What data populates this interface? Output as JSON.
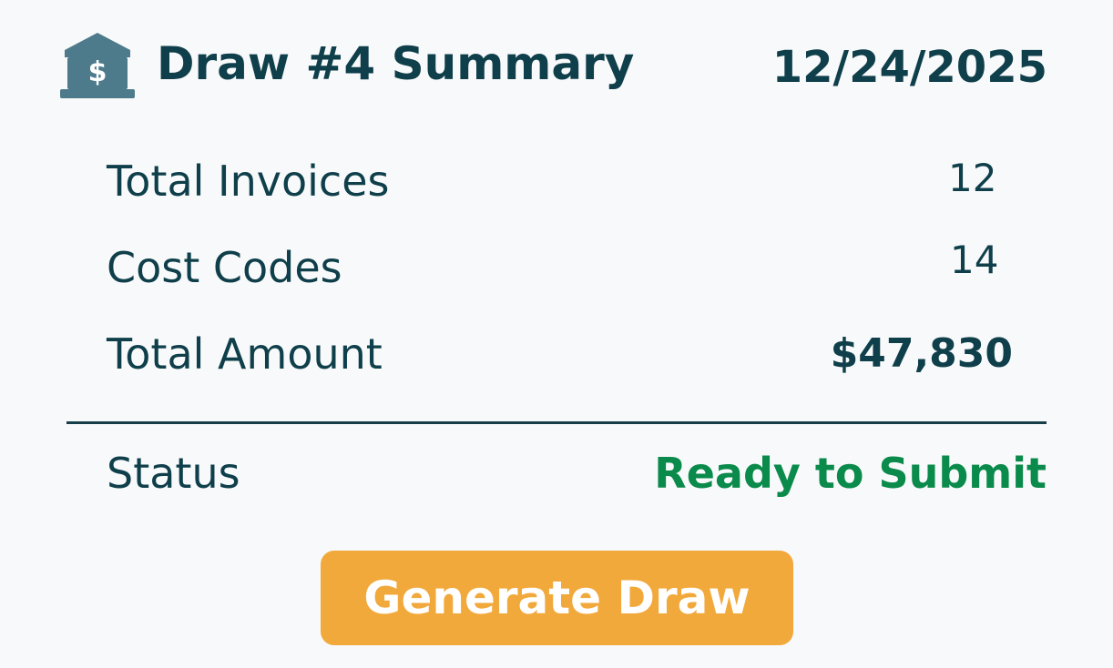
{
  "header": {
    "icon": "bank-dollar-icon",
    "title": "Draw #4 Summary",
    "date": "12/24/2025"
  },
  "metrics": [
    {
      "label": "Total Invoices",
      "value": "12"
    },
    {
      "label": "Cost Codes",
      "value": "14"
    },
    {
      "label": "Total Amount",
      "value": "$47,830"
    }
  ],
  "status": {
    "label": "Status",
    "value": "Ready to Submit",
    "color": "#0a8a4b"
  },
  "actions": {
    "generate_label": "Generate Draw"
  },
  "colors": {
    "text": "#0e3f4a",
    "icon": "#4d7b8b",
    "button": "#f2a93b",
    "button_text": "#ffffff",
    "background": "#f8f9fa"
  }
}
